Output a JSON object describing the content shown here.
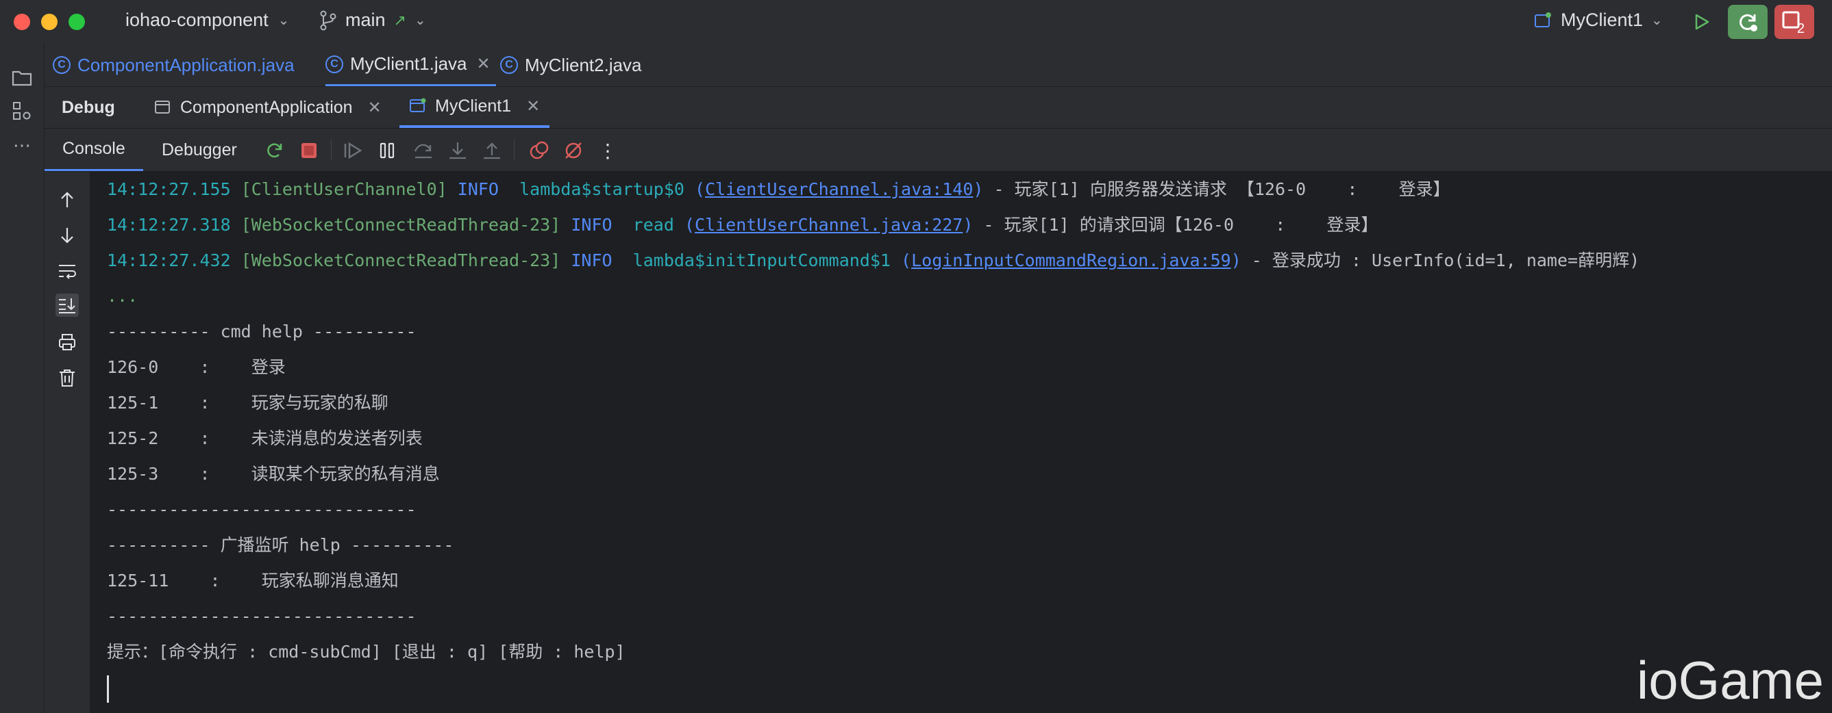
{
  "titlebar": {
    "project": "iohao-component",
    "branch": "main",
    "run_config": "MyClient1"
  },
  "file_tabs": [
    {
      "label": "ComponentApplication.java"
    },
    {
      "label": "MyClient1.java"
    },
    {
      "label": "MyClient2.java"
    }
  ],
  "debug": {
    "title": "Debug",
    "tabs": [
      {
        "label": "ComponentApplication"
      },
      {
        "label": "MyClient1"
      }
    ]
  },
  "toolbar": {
    "console_label": "Console",
    "debugger_label": "Debugger"
  },
  "console": {
    "log": [
      {
        "ts": "14:12:27.155",
        "thread": "[ClientUserChannel0]",
        "level": "INFO",
        "method": "lambda$startup$0",
        "link": "ClientUserChannel.java:140",
        "msg": " - 玩家[1] 向服务器发送请求 【126-0    :    登录】"
      },
      {
        "ts": "14:12:27.318",
        "thread": "[WebSocketConnectReadThread-23]",
        "level": "INFO",
        "method": "read",
        "link": "ClientUserChannel.java:227",
        "msg": " - 玩家[1] 的请求回调【126-0    :    登录】"
      },
      {
        "ts": "14:12:27.432",
        "thread": "[WebSocketConnectReadThread-23]",
        "level": "INFO",
        "method": "lambda$initInputCommand$1",
        "link": "LoginInputCommandRegion.java:59",
        "msg": " - 登录成功 : UserInfo(id=1, name=薛明辉)"
      }
    ],
    "dots": "...",
    "plain": [
      "---------- cmd help ----------",
      "126-0    :    登录",
      "125-1    :    玩家与玩家的私聊",
      "125-2    :    未读消息的发送者列表",
      "125-3    :    读取某个玩家的私有消息",
      "------------------------------",
      "---------- 广播监听 help ----------",
      "125-11    :    玩家私聊消息通知",
      "------------------------------",
      "提示：[命令执行 : cmd-subCmd] [退出 : q] [帮助 : help]"
    ]
  },
  "watermark": "ioGame"
}
